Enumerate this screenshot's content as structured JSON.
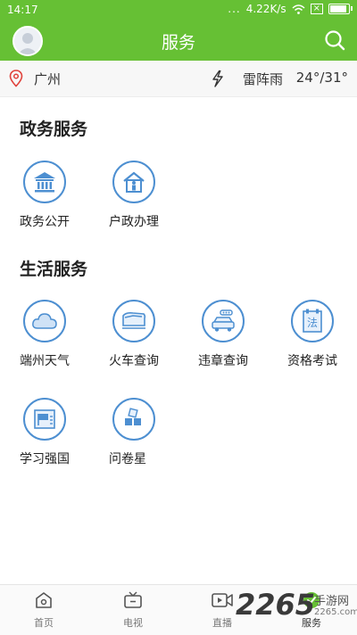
{
  "status_bar": {
    "time": "14:17",
    "dots": "...",
    "speed": "4.22K/s",
    "x_badge": "×"
  },
  "header": {
    "title": "服务"
  },
  "location": {
    "city": "广州",
    "weather": "雷阵雨",
    "temperature": "24°/31°"
  },
  "sections": {
    "gov": {
      "title": "政务服务",
      "items": [
        {
          "label": "政务公开",
          "icon": "government-building-icon"
        },
        {
          "label": "户政办理",
          "icon": "household-registration-icon"
        }
      ]
    },
    "life": {
      "title": "生活服务",
      "items": [
        {
          "label": "端州天气",
          "icon": "cloud-icon"
        },
        {
          "label": "火车查询",
          "icon": "train-icon"
        },
        {
          "label": "违章查询",
          "icon": "car-icon"
        },
        {
          "label": "资格考试",
          "icon": "law-book-icon"
        },
        {
          "label": "学习强国",
          "icon": "study-flag-icon"
        },
        {
          "label": "问卷星",
          "icon": "grid-blocks-icon"
        }
      ]
    }
  },
  "tabs": [
    {
      "label": "首页",
      "icon": "home-icon"
    },
    {
      "label": "电视",
      "icon": "tv-icon"
    },
    {
      "label": "直播",
      "icon": "video-icon"
    },
    {
      "label": "服务",
      "icon": "service-icon",
      "active": true
    }
  ],
  "watermark": {
    "number": "2265",
    "text": "手游网",
    "url": "2265.com"
  },
  "colors": {
    "brand_green": "#66c034",
    "icon_blue": "#4d8fd1"
  }
}
